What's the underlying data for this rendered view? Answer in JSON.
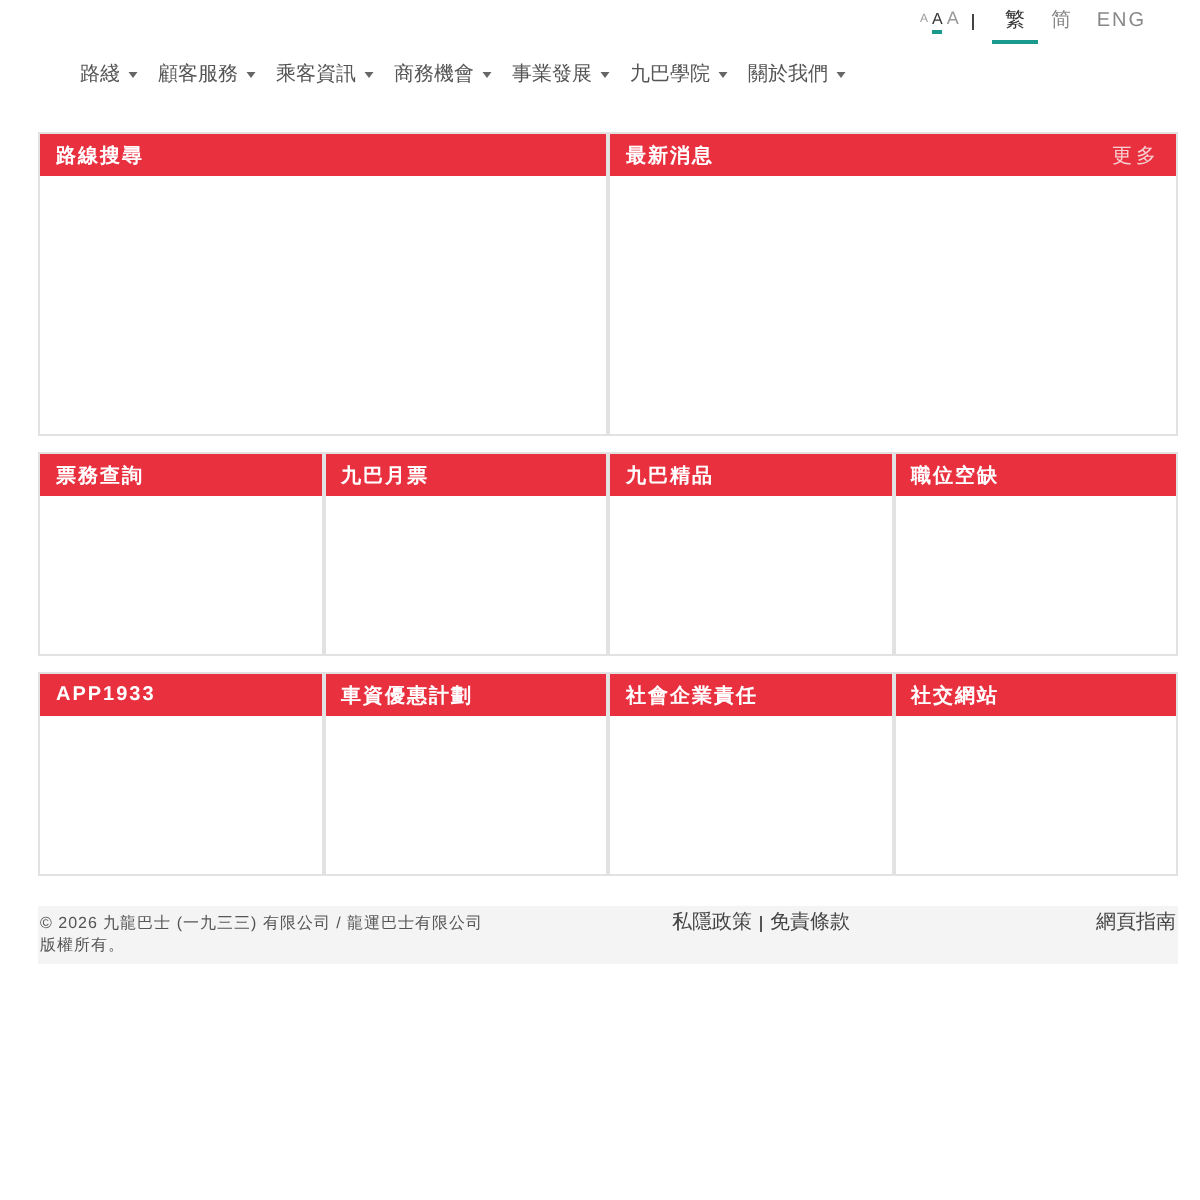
{
  "font_size": [
    {
      "label": "A",
      "kind": "small",
      "selected": false
    },
    {
      "label": "A",
      "kind": "medium",
      "selected": true
    },
    {
      "label": "A",
      "kind": "large",
      "selected": false
    }
  ],
  "languages": [
    {
      "label": "繁",
      "selected": true
    },
    {
      "label": "简",
      "selected": false
    },
    {
      "label": "ENG",
      "selected": false
    }
  ],
  "nav": [
    {
      "label": "路綫"
    },
    {
      "label": "顧客服務"
    },
    {
      "label": "乘客資訊"
    },
    {
      "label": "商務機會"
    },
    {
      "label": "事業發展"
    },
    {
      "label": "九巴學院"
    },
    {
      "label": "關於我們"
    }
  ],
  "panel_rows": [
    [
      {
        "title": "路線搜尋"
      },
      {
        "title": "最新消息",
        "link": "更多"
      }
    ],
    [
      {
        "title": "票務查詢"
      },
      {
        "title": "九巴月票"
      },
      {
        "title": "九巴精品"
      },
      {
        "title": "職位空缺"
      }
    ],
    [
      {
        "title": "APP1933"
      },
      {
        "title": "車資優惠計劃"
      },
      {
        "title": "社會企業責任"
      },
      {
        "title": "社交網站"
      }
    ]
  ],
  "footer": {
    "copyright": "© 2026 九龍巴士 (一九三三) 有限公司 / 龍運巴士有限公司版權所有。",
    "links": [
      "私隱政策",
      "免責條款"
    ],
    "guide": "網頁指南"
  }
}
